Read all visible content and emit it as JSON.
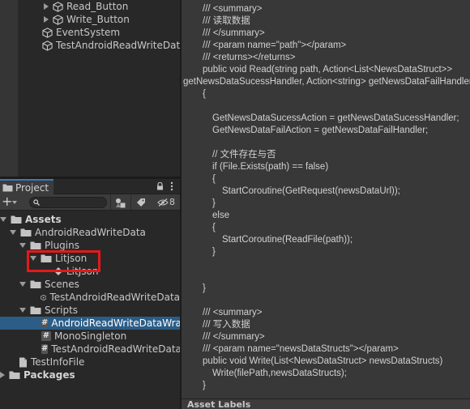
{
  "hierarchy": {
    "items": [
      {
        "label": "Read_Button",
        "type": "gameobject",
        "collapsed": true
      },
      {
        "label": "Write_Button",
        "type": "gameobject",
        "collapsed": true
      },
      {
        "label": "EventSystem",
        "type": "gameobject"
      },
      {
        "label": "TestAndroidReadWriteData",
        "type": "gameobject"
      }
    ]
  },
  "project_panel": {
    "tab_label": "Project",
    "search": {
      "value": "",
      "placeholder": ""
    },
    "hidden_count": "8",
    "tree": [
      {
        "label": "Assets",
        "kind": "folder",
        "bold": true,
        "depth": 0,
        "expanded": true
      },
      {
        "label": "AndroidReadWriteData",
        "kind": "folder",
        "depth": 1,
        "expanded": true
      },
      {
        "label": "Plugins",
        "kind": "folder",
        "depth": 2,
        "expanded": true
      },
      {
        "label": "Litjson",
        "kind": "folder",
        "depth": 3,
        "expanded": true
      },
      {
        "label": "LitJson",
        "kind": "asset",
        "depth": 4
      },
      {
        "label": "Scenes",
        "kind": "folder",
        "depth": 2,
        "expanded": true
      },
      {
        "label": "TestAndroidReadWriteData",
        "kind": "scene",
        "depth": 3
      },
      {
        "label": "Scripts",
        "kind": "folder",
        "depth": 2,
        "expanded": true
      },
      {
        "label": "AndroidReadWriteDataWrapper",
        "kind": "script",
        "depth": 3,
        "selected": true
      },
      {
        "label": "MonoSingleton",
        "kind": "script",
        "depth": 3
      },
      {
        "label": "TestAndroidReadWriteData",
        "kind": "script",
        "depth": 3
      },
      {
        "label": "TestInfoFile",
        "kind": "text",
        "depth": 1
      },
      {
        "label": "Packages",
        "kind": "folder",
        "bold": true,
        "depth": 0,
        "expanded": false
      }
    ]
  },
  "code_preview": {
    "lines": [
      "/// <summary>",
      "/// 读取数据",
      "/// </summary>",
      "/// <param name=\"path\"></param>",
      "/// <returns></returns>",
      "public void Read(string path, Action<List<NewsDataStruct>>",
      "getNewsDataSucessHandler, Action<string> getNewsDataFailHandler)",
      "{",
      "",
      "GetNewsDataSucessAction = getNewsDataSucessHandler;",
      "GetNewsDataFailAction = getNewsDataFailHandler;",
      "",
      "// 文件存在与否",
      "if (File.Exists(path) == false)",
      "{",
      "StartCoroutine(GetRequest(newsDataUrl));",
      "}",
      "else",
      "{",
      "StartCoroutine(ReadFile(path));",
      "}",
      "",
      "",
      "}",
      "",
      "/// <summary>",
      "/// 写入数据",
      "/// </summary>",
      "/// <param name=\"newsDataStructs\"></param>",
      "public void Write(List<NewsDataStruct> newsDataStructs)",
      "Write(filePath,newsDataStructs);",
      "}"
    ],
    "asset_labels_title": "Asset Labels"
  },
  "colors": {
    "selection": "#2c5d87",
    "highlight_box": "#e21a1a",
    "active_tab_accent": "#3a79bb"
  }
}
